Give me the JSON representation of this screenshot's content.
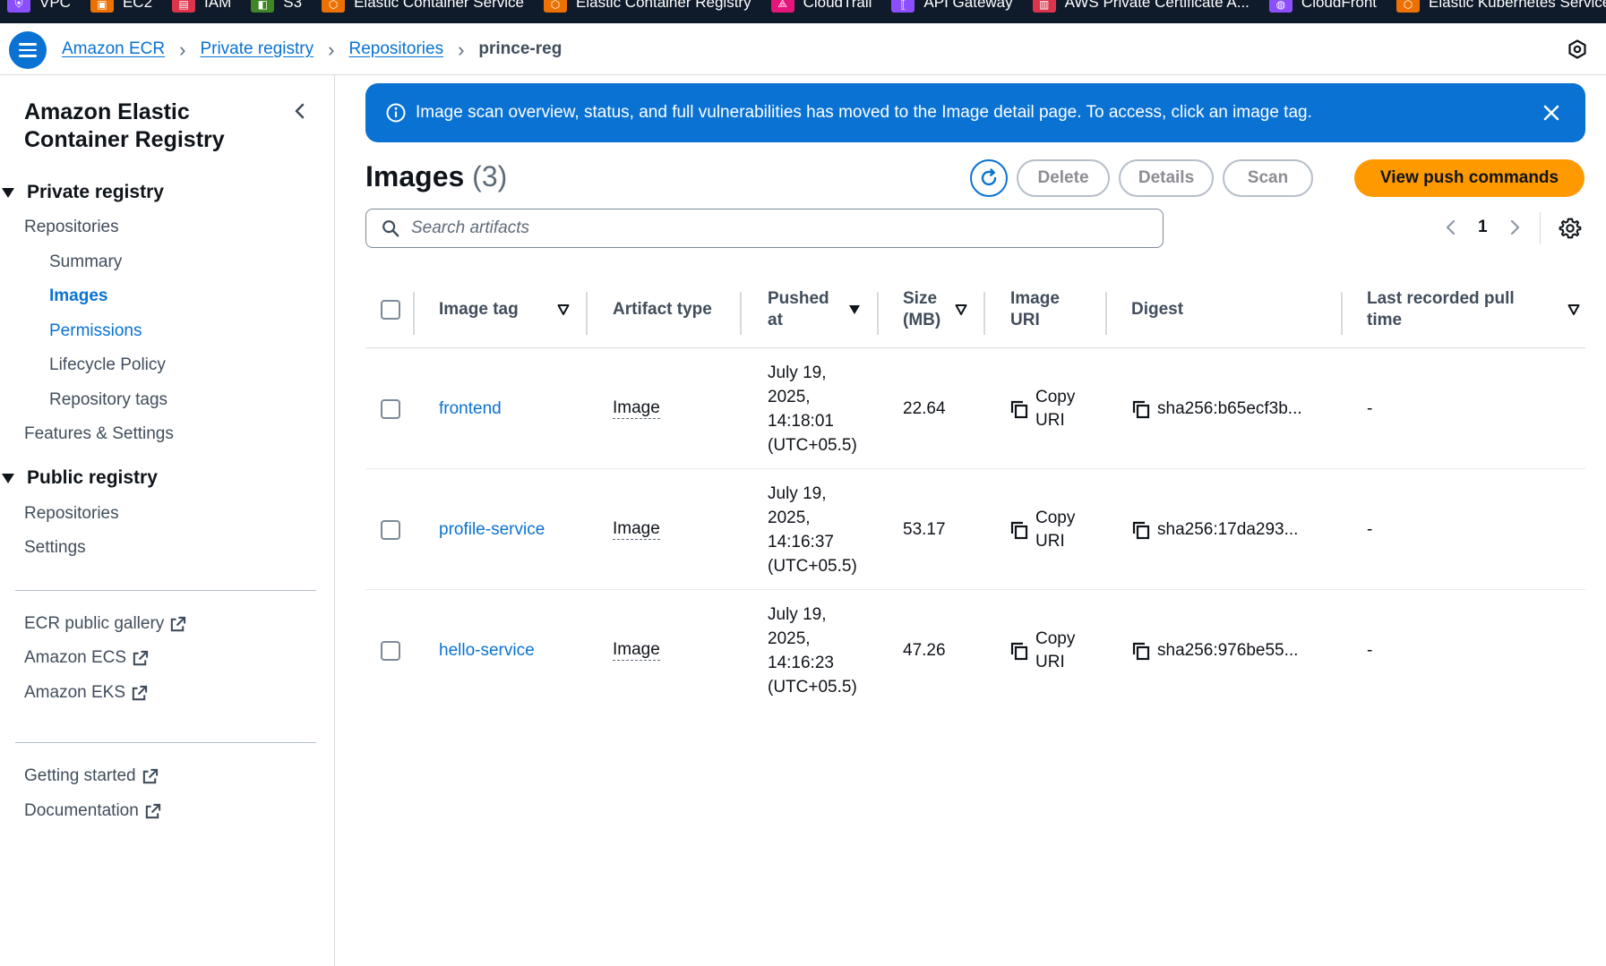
{
  "favorites": [
    {
      "label": "VPC",
      "color": "#8c4fff",
      "icon": "vpc-icon"
    },
    {
      "label": "EC2",
      "color": "#ed7100",
      "icon": "ec2-icon"
    },
    {
      "label": "IAM",
      "color": "#dd344c",
      "icon": "iam-icon"
    },
    {
      "label": "S3",
      "color": "#3f8624",
      "icon": "s3-icon"
    },
    {
      "label": "Elastic Container Service",
      "color": "#ed7100",
      "icon": "ecs-icon"
    },
    {
      "label": "Elastic Container Registry",
      "color": "#ed7100",
      "icon": "ecr-icon"
    },
    {
      "label": "CloudTrail",
      "color": "#e7157b",
      "icon": "cloudtrail-icon"
    },
    {
      "label": "API Gateway",
      "color": "#8c4fff",
      "icon": "api-gateway-icon"
    },
    {
      "label": "AWS Private Certificate A...",
      "color": "#dd344c",
      "icon": "private-ca-icon"
    },
    {
      "label": "CloudFront",
      "color": "#8c4fff",
      "icon": "cloudfront-icon"
    },
    {
      "label": "Elastic Kubernetes Service",
      "color": "#ed7100",
      "icon": "eks-icon"
    }
  ],
  "breadcrumb": {
    "items": [
      "Amazon ECR",
      "Private registry",
      "Repositories"
    ],
    "current": "prince-reg"
  },
  "sidebar": {
    "title": "Amazon Elastic Container Registry",
    "private_registry": {
      "label": "Private registry",
      "repositories": "Repositories",
      "sub_items": [
        "Summary",
        "Images",
        "Permissions",
        "Lifecycle Policy",
        "Repository tags"
      ],
      "active": "Images",
      "features": "Features & Settings"
    },
    "public_registry": {
      "label": "Public registry",
      "items": [
        "Repositories",
        "Settings"
      ]
    },
    "external_links": [
      "ECR public gallery",
      "Amazon ECS",
      "Amazon EKS"
    ],
    "help_links": [
      "Getting started",
      "Documentation"
    ]
  },
  "flash": {
    "message": "Image scan overview, status, and full vulnerabilities has moved to the Image detail page. To access, click an image tag."
  },
  "images": {
    "title": "Images",
    "count": "(3)",
    "buttons": {
      "delete": "Delete",
      "details": "Details",
      "scan": "Scan",
      "push": "View push commands"
    },
    "search_placeholder": "Search artifacts",
    "page": "1",
    "columns": {
      "tag": "Image tag",
      "artifact": "Artifact type",
      "pushed_line1": "Pushed",
      "pushed_line2": "at",
      "size_line1": "Size",
      "size_line2": "(MB)",
      "uri_line1": "Image",
      "uri_line2": "URI",
      "digest": "Digest",
      "pull_line1": "Last recorded pull",
      "pull_line2": "time"
    },
    "copy_line1": "Copy",
    "copy_line2": "URI",
    "rows": [
      {
        "tag": "frontend",
        "artifact": "Image",
        "pushed": [
          "July 19,",
          "2025,",
          "14:18:01",
          "(UTC+05.5)"
        ],
        "size": "22.64",
        "digest": "sha256:b65ecf3b...",
        "pull": "-"
      },
      {
        "tag": "profile-service",
        "artifact": "Image",
        "pushed": [
          "July 19,",
          "2025,",
          "14:16:37",
          "(UTC+05.5)"
        ],
        "size": "53.17",
        "digest": "sha256:17da293...",
        "pull": "-"
      },
      {
        "tag": "hello-service",
        "artifact": "Image",
        "pushed": [
          "July 19,",
          "2025,",
          "14:16:23",
          "(UTC+05.5)"
        ],
        "size": "47.26",
        "digest": "sha256:976be55...",
        "pull": "-"
      }
    ]
  },
  "colors": {
    "accent": "#0972d3",
    "primary_button": "#ff9900",
    "favorites_bar": "#0f1b2a"
  }
}
